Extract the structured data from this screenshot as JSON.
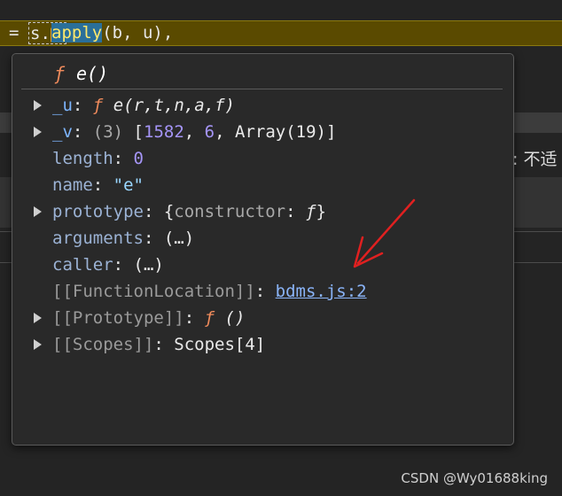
{
  "editor": {
    "equals": "=",
    "object": "s.",
    "marker": "?",
    "method": "apply",
    "args": "(b, u),",
    "background_text": ": 不适"
  },
  "popover": {
    "header": {
      "fn_symbol": "ƒ",
      "fn_name": "e()"
    },
    "props": {
      "u": {
        "key": "_u",
        "sep": ": ",
        "fn_symbol": "ƒ",
        "value": "e(r,t,n,a,f)"
      },
      "v": {
        "key": "_v",
        "sep": ": ",
        "count": "(3) ",
        "open": "[",
        "num1": "1582",
        "comma1": ", ",
        "num2": "6",
        "comma2": ", ",
        "arr": "Array(19)",
        "close": "]"
      },
      "length": {
        "key": "length",
        "sep": ": ",
        "value": "0"
      },
      "name": {
        "key": "name",
        "sep": ": ",
        "value": "\"e\""
      },
      "prototype": {
        "key": "prototype",
        "sep": ": ",
        "open": "{",
        "inner_key": "constructor",
        "inner_sep": ": ",
        "fn_symbol": "ƒ",
        "close": "}"
      },
      "arguments": {
        "key": "arguments",
        "sep": ": ",
        "value": "(…)"
      },
      "caller": {
        "key": "caller",
        "sep": ": ",
        "value": "(…)"
      },
      "function_location": {
        "key": "[[FunctionLocation]]",
        "sep": ": ",
        "value": "bdms.js:2"
      },
      "proto_internal": {
        "key": "[[Prototype]]",
        "sep": ": ",
        "fn_symbol": "ƒ",
        "value": " ()"
      },
      "scopes": {
        "key": "[[Scopes]]",
        "sep": ": ",
        "value": "Scopes[4]"
      }
    }
  },
  "annotation": {
    "color": "#e02020"
  },
  "watermark": "CSDN @Wy01688king",
  "colors": {
    "key": "#7eb6ff",
    "function": "#f08b5c",
    "number": "#a595f7",
    "string": "#9ad7ff",
    "link": "#8ab4f8",
    "line_highlight": "#5a4a00"
  }
}
